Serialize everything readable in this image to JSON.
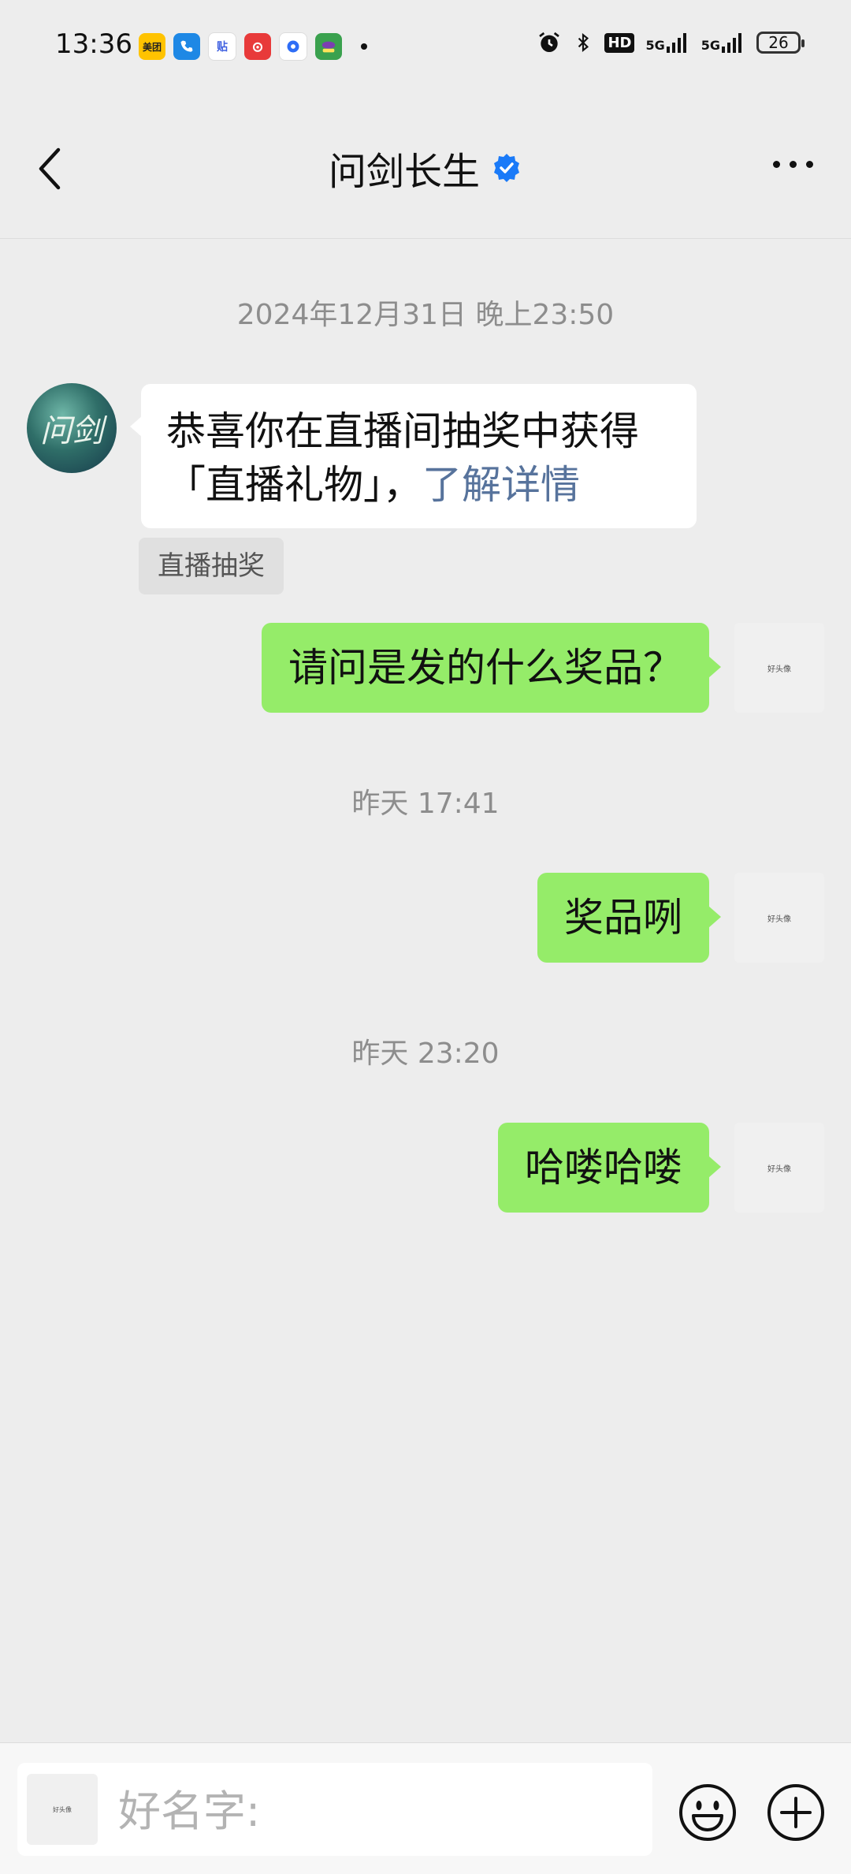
{
  "status_bar": {
    "time": "13:36",
    "app_icons": [
      {
        "name": "meituan-icon",
        "label": "美团",
        "color": "#ffc300"
      },
      {
        "name": "phone-icon",
        "label": "",
        "color": "#1e88e5"
      },
      {
        "name": "tieba-icon",
        "label": "贴",
        "color": "#3e5fe0"
      },
      {
        "name": "netease-music-icon",
        "label": "",
        "color": "#e83a3a"
      },
      {
        "name": "browser-icon",
        "label": "",
        "color": "#2e6df6"
      },
      {
        "name": "game-app-icon",
        "label": "",
        "color": "#3aa14e"
      }
    ],
    "hd_label": "HD",
    "signal_1": "5G",
    "signal_2": "5G",
    "battery": "26"
  },
  "header": {
    "title": "问剑长生",
    "verified_color": "#1a7af8"
  },
  "messages": {
    "ts1": "2024年12月31日 晚上23:50",
    "bot_avatar_text": "问剑",
    "bot_text": "恭喜你在直播间抽奖中获得「直播礼物」，",
    "bot_link": "了解详情",
    "bot_tag": "直播抽奖",
    "me1": "请问是发的什么奖品？",
    "ts2": "昨天 17:41",
    "me2": "奖品咧",
    "ts3": "昨天 23:20",
    "me3": "哈喽哈喽",
    "my_avatar_text": "好头像"
  },
  "input": {
    "placeholder": "好名字:",
    "avatar_text": "好头像"
  },
  "colors": {
    "bubble_me": "#95ec69",
    "link": "#57739c",
    "background": "#ededed"
  }
}
